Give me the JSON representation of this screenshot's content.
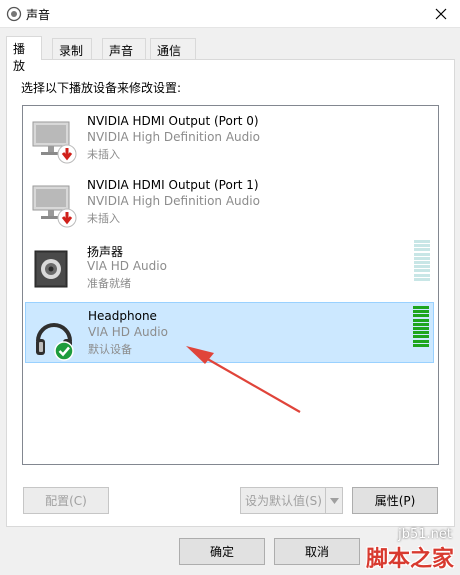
{
  "window": {
    "title": "声音",
    "close_icon": "close-icon",
    "app_icon": "speaker-icon"
  },
  "tabs": [
    {
      "label": "播放",
      "active": true
    },
    {
      "label": "录制",
      "active": false
    },
    {
      "label": "声音",
      "active": false
    },
    {
      "label": "通信",
      "active": false
    }
  ],
  "instruction": "选择以下播放设备来修改设置:",
  "devices": [
    {
      "name": "NVIDIA HDMI Output (Port 0)",
      "desc": "NVIDIA High Definition Audio",
      "status": "未插入",
      "icon": "monitor-icon",
      "badge": "unplugged-badge-icon",
      "selected": false,
      "level": 0
    },
    {
      "name": "NVIDIA HDMI Output (Port 1)",
      "desc": "NVIDIA High Definition Audio",
      "status": "未插入",
      "icon": "monitor-icon",
      "badge": "unplugged-badge-icon",
      "selected": false,
      "level": 0
    },
    {
      "name": "扬声器",
      "desc": "VIA HD Audio",
      "status": "准备就绪",
      "icon": "speaker-icon",
      "badge": "",
      "selected": false,
      "level": 0
    },
    {
      "name": "Headphone",
      "desc": "VIA HD Audio",
      "status": "默认设备",
      "icon": "headphone-icon",
      "badge": "default-check-badge-icon",
      "selected": true,
      "level": 1.0
    }
  ],
  "buttons": {
    "configure": "配置(C)",
    "set_default": "设为默认值(S)",
    "properties": "属性(P)",
    "ok": "确定",
    "cancel": "取消"
  },
  "colors": {
    "selection": "#cce8ff",
    "meter_on": "#1ea51e",
    "meter_off": "#c8e6e6",
    "arrow": "#e0443a"
  },
  "watermark": {
    "site": "jb51.net",
    "brand": "脚本之家"
  }
}
